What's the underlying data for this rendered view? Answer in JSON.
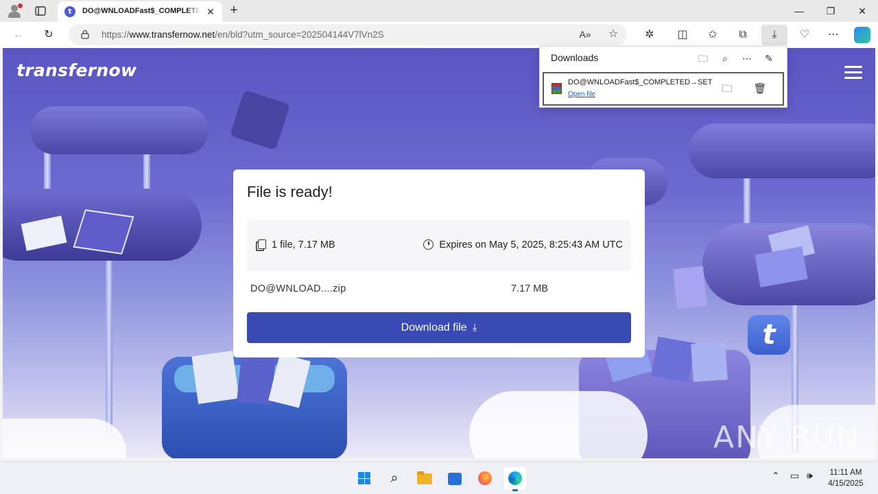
{
  "browser": {
    "tab_title": "DO@WNLOADFast$_COMPLETED",
    "tab_favicon": "t",
    "address_prefix": "https://",
    "address_host": "www.transfernow.net",
    "address_path": "/en/bld?utm_source=202504144V7lVn2S",
    "window_controls": {
      "minimize": "—",
      "maximize": "❐",
      "close": "✕"
    }
  },
  "downloads_flyout": {
    "title": "Downloads",
    "item_name": "DO@WNLOADFast$_COMPLETED→SET",
    "item_action": "Open file"
  },
  "page": {
    "logo": "transfernow",
    "badge_letter": "t",
    "card": {
      "title": "File is ready!",
      "file_count": "1 file, 7.17 MB",
      "expires": "Expires on May 5, 2025, 8:25:43 AM UTC",
      "file_name": "DO@WNLOAD....zip",
      "file_size": "7.17 MB",
      "download_label": "Download file"
    },
    "watermark": "ANY RUN"
  },
  "taskbar": {
    "time": "11:11 AM",
    "date": "4/15/2025"
  },
  "colors": {
    "primary_button": "#3a4ab4",
    "link": "#0f5fbf",
    "page_gradient_top": "#5a55c2"
  }
}
